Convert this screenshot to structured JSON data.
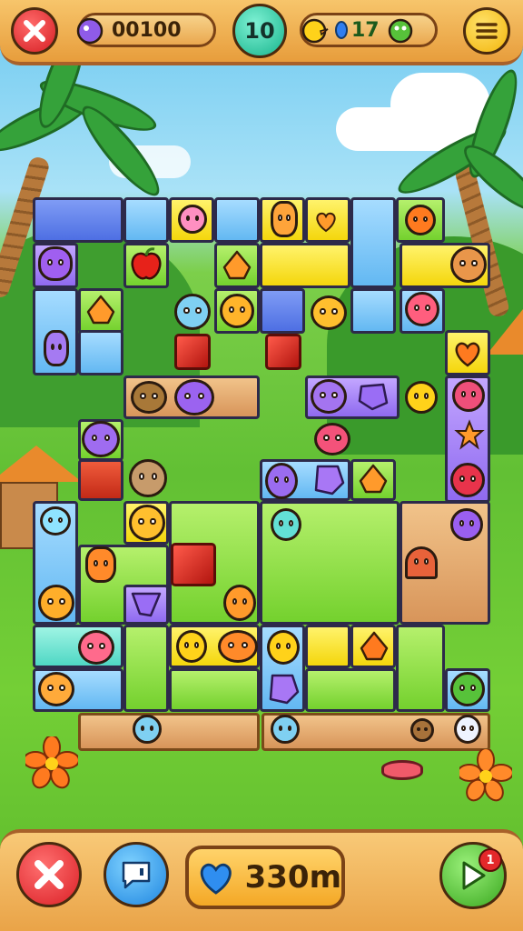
{
  "top_bar": {
    "close_icon": "close-x-icon",
    "score": "00100",
    "moves": "10",
    "gems": "17",
    "menu_icon": "hamburger-menu-icon"
  },
  "bottom_bar": {
    "close_icon": "close-x-icon",
    "hint_icon": "speech-bubble-icon",
    "distance": "330m",
    "play_icon": "play-icon",
    "play_badge": "1"
  },
  "colors": {
    "yellow_tile": "#f4d60c",
    "blue_tile": "#63b8f2",
    "green_tile": "#74d12e",
    "purple_tile": "#8f6af0",
    "red_gem": "#c32a17",
    "bar": "#eaa84f"
  }
}
